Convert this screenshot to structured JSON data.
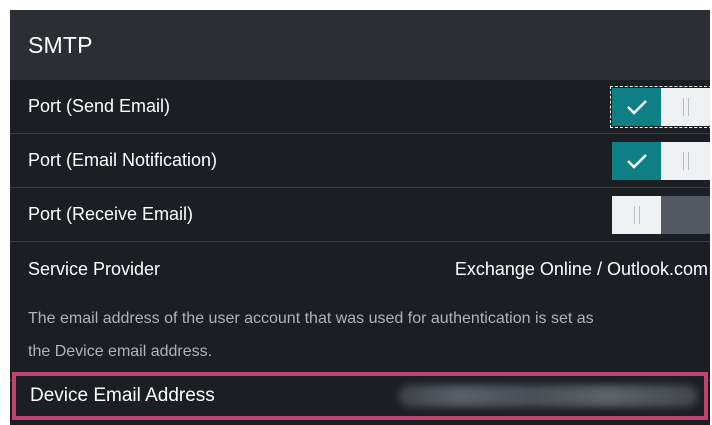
{
  "section": {
    "title": "SMTP"
  },
  "rows": [
    {
      "label": "Port (Send Email)",
      "toggle": "on"
    },
    {
      "label": "Port (Email Notification)",
      "toggle": "on"
    },
    {
      "label": "Port (Receive Email)",
      "toggle": "off"
    }
  ],
  "service_provider": {
    "label": "Service Provider",
    "value": "Exchange Online / Outlook.com"
  },
  "description": {
    "line1": "The email address of the user account that was used for authentication is set as",
    "line2": "the Device email address."
  },
  "device_email": {
    "label": "Device Email Address"
  },
  "colors": {
    "toggle_on": "#0f7f86",
    "toggle_off": "#545961",
    "highlight_border": "#c2426f",
    "panel_bg": "#1b1e22",
    "header_bg": "#2b2f34"
  },
  "icons": {
    "check": "check-icon",
    "grip": "grip-icon"
  }
}
